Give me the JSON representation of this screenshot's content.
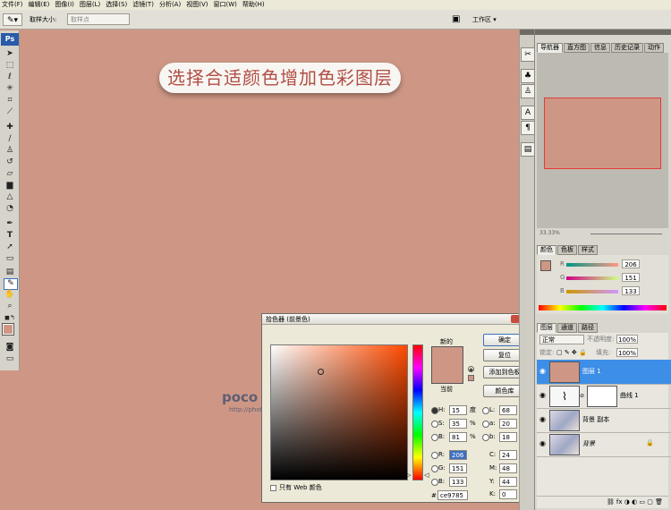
{
  "menu": [
    "文件(F)",
    "编辑(E)",
    "图像(I)",
    "图层(L)",
    "选择(S)",
    "滤镜(T)",
    "分析(A)",
    "视图(V)",
    "窗口(W)",
    "帮助(H)"
  ],
  "options": {
    "sample_size_label": "取样大小:",
    "sample_size_value": "取样点",
    "workspace_label": "工作区 ▾"
  },
  "banner": {
    "text": "选择合适颜色增加色彩图层"
  },
  "watermark": {
    "logo": "poco 摄影专题",
    "url": "http://photo.poco.cn/"
  },
  "toolbox": {
    "logo": "Ps"
  },
  "navigator": {
    "tabs": [
      "导航器",
      "直方图",
      "信息",
      "历史记录",
      "动作"
    ],
    "zoom": "33.33%"
  },
  "color_panel": {
    "tabs": [
      "颜色",
      "色板",
      "样式"
    ],
    "r": "206",
    "g": "151",
    "b": "133",
    "r_label": "R",
    "g_label": "G",
    "b_label": "B"
  },
  "layers_panel": {
    "tabs": [
      "图层",
      "通道",
      "路径"
    ],
    "blend_mode": "正常",
    "opacity_label": "不透明度:",
    "opacity": "100%",
    "lock_label": "锁定:",
    "fill_label": "填充:",
    "fill": "100%",
    "layers": [
      {
        "name": "图层 1",
        "selected": true
      },
      {
        "name": "曲线 1",
        "selected": false
      },
      {
        "name": "背景 副本",
        "selected": false
      },
      {
        "name": "背景",
        "selected": false
      }
    ]
  },
  "picker": {
    "title": "拾色器 (前景色)",
    "new_label": "新的",
    "current_label": "当前",
    "ok": "确定",
    "reset": "复位",
    "add_swatch": "添加到色板",
    "color_libraries": "颜色库",
    "only_web": "只有 Web 颜色",
    "h_label": "H:",
    "h": "15",
    "h_unit": "度",
    "s_label": "S:",
    "s": "35",
    "s_unit": "%",
    "b_label": "B:",
    "b": "81",
    "b_unit": "%",
    "r_label": "R:",
    "r": "206",
    "g_label": "G:",
    "g": "151",
    "bb_label": "B:",
    "bb": "133",
    "l_label": "L:",
    "l": "68",
    "a_label": "a:",
    "a": "20",
    "lb_label": "b:",
    "lb": "18",
    "c_label": "C:",
    "c": "24",
    "m_label": "M:",
    "m": "48",
    "y_label": "Y:",
    "y": "44",
    "k_label": "K:",
    "k": "0",
    "pct": "%",
    "hex_label": "#",
    "hex": "ce9785"
  },
  "colors": {
    "canvas": "#ce9785",
    "foreground": "#ce9785",
    "selected_layer": "#3d8ee6"
  }
}
